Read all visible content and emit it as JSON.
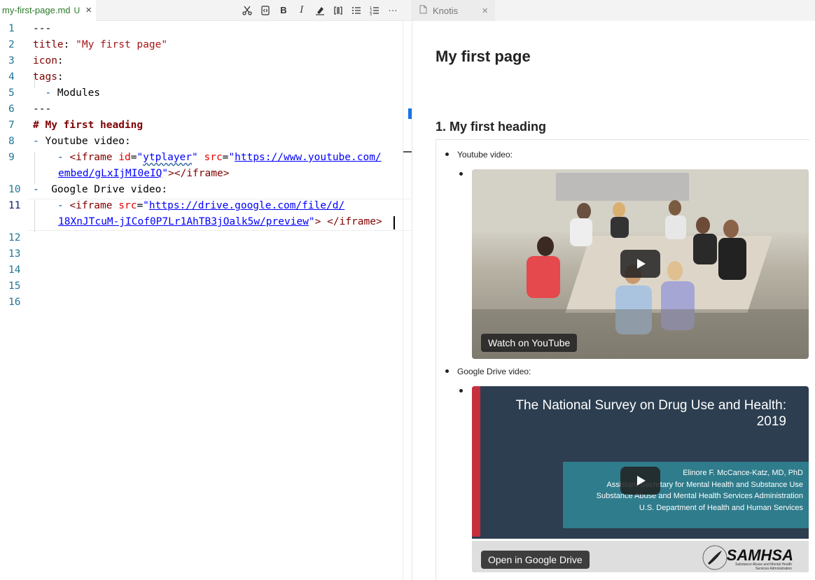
{
  "editor": {
    "tab": {
      "filename": "my-first-page.md",
      "status": "U"
    },
    "toolbar": [
      "cut-icon",
      "code-icon",
      "bold-icon",
      "italic-icon",
      "highlight-icon",
      "columns-icon",
      "bullet-list-icon",
      "numbered-list-icon",
      "more-icon"
    ],
    "toolbar_labels": {
      "bold": "B",
      "italic": "I",
      "more": "···"
    },
    "line_numbers": [
      "1",
      "2",
      "3",
      "4",
      "5",
      "6",
      "7",
      "8",
      "9",
      "10",
      "11",
      "12",
      "13",
      "14",
      "15",
      "16"
    ],
    "code": {
      "l1": "---",
      "l2_key": "title",
      "l2_colon": ": ",
      "l2_val": "\"My first page\"",
      "l3_key": "icon",
      "l3_colon": ":",
      "l4_key": "tags",
      "l4_colon": ":",
      "l5_dash": "  - ",
      "l5_val": "Modules",
      "l6": "---",
      "l7": "# My first heading",
      "l8_dash": "- ",
      "l8_val": "Youtube video:",
      "l9_dash": "    - ",
      "l9_open": "<iframe ",
      "l9_attr1": "id",
      "l9_eq1": "=",
      "l9_q1": "\"",
      "l9_val1": "ytplayer",
      "l9_q2": "\"",
      "l9_attr2": " src",
      "l9_eq2": "=",
      "l9_q3": "\"",
      "l9_url1": "https://www.youtube.com/",
      "l9b_url2": "embed/gLxIjMI0eIQ",
      "l9b_q4": "\"",
      "l9b_close": "></iframe>",
      "l10_dash": "-  ",
      "l10_val": "Google Drive video:",
      "l11_dash": "    - ",
      "l11_open": "<iframe ",
      "l11_attr": "src",
      "l11_eq": "=",
      "l11_q1": "\"",
      "l11_url1": "https://drive.google.com/file/d/",
      "l11b_url2": "18XnJTcuM-jICof0P7Lr1AhTB3jOalk5w/preview",
      "l11b_q2": "\"",
      "l11b_close": "> </iframe>"
    }
  },
  "preview": {
    "tab": {
      "title": "Knotis"
    },
    "page_title": "My first page",
    "heading": "1. My first heading",
    "items": [
      {
        "label": "Youtube video:",
        "embed_button": "Watch on YouTube"
      },
      {
        "label": "Google Drive video:",
        "embed_button": "Open in Google Drive"
      }
    ],
    "slide": {
      "title": "The National Survey on Drug Use and Health: 2019",
      "lines": [
        "Elinore F. McCance-Katz, MD, PhD",
        "Assistant Secretary for Mental Health and Substance Use",
        "Substance Abuse and Mental Health Services Administration",
        "U.S. Department of Health and Human Services"
      ],
      "logo": "SAMHSA",
      "logo_sub": "Substance Abuse and Mental Health Services Administration"
    }
  }
}
